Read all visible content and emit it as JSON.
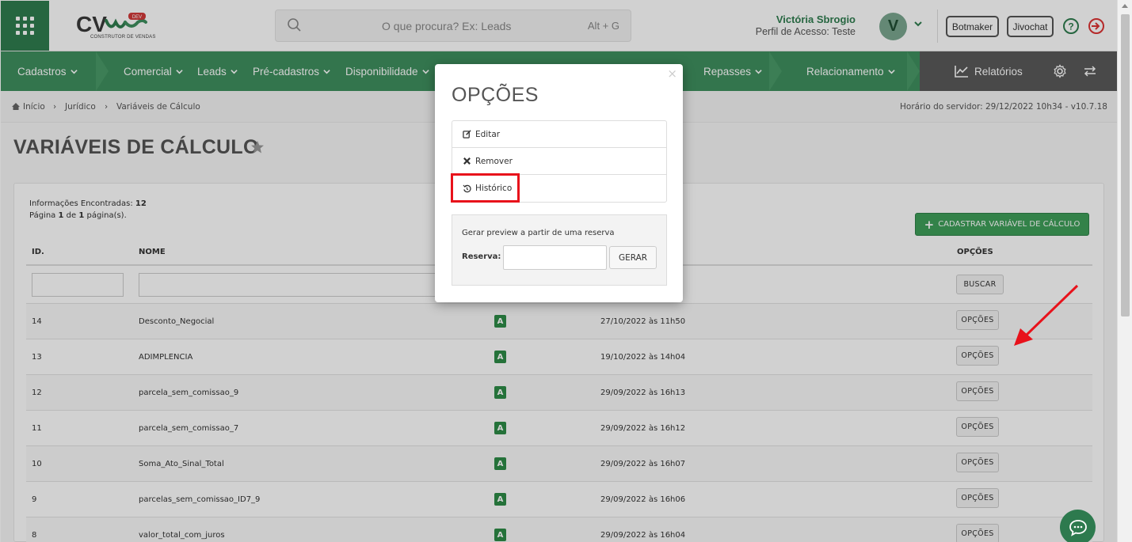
{
  "header": {
    "logo_text": "CV",
    "logo_badge": "DEV",
    "logo_subtitle": "CONSTRUTOR DE VENDAS",
    "search_placeholder": "O que procura? Ex: Leads",
    "search_shortcut": "Alt + G",
    "user_name": "Victória Sbrogio",
    "user_role": "Perfil de Acesso: Teste",
    "avatar_letter": "V",
    "buttons": [
      "Botmaker",
      "Jivochat"
    ]
  },
  "nav": {
    "items": [
      "Cadastros",
      "Comercial",
      "Leads",
      "Pré-cadastros",
      "Disponibilidade",
      "Repasses",
      "Relacionamento"
    ],
    "reports": "Relatórios"
  },
  "breadcrumb": {
    "items": [
      "Início",
      "Jurídico",
      "Variáveis de Cálculo"
    ],
    "server_time": "Horário do servidor: 29/12/2022 10h34 - v10.7.18"
  },
  "page": {
    "title": "VARIÁVEIS DE CÁLCULO",
    "info_found_label": "Informações Encontradas:",
    "info_found_value": "12",
    "page_info_pre": "Página",
    "page_info_current": "1",
    "page_info_mid": "de",
    "page_info_total": "1",
    "page_info_post": "página(s).",
    "add_button": "CADASTRAR VARIÁVEL DE CÁLCULO"
  },
  "table": {
    "headers": [
      "ID.",
      "NOME",
      "OPÇÕES"
    ],
    "search_button": "BUSCAR",
    "options_button": "OPÇÕES",
    "rows": [
      {
        "id": "14",
        "name": "Desconto_Negocial",
        "status": "A",
        "date": "27/10/2022 às 11h50"
      },
      {
        "id": "13",
        "name": "ADIMPLENCIA",
        "status": "A",
        "date": "19/10/2022 às 14h04"
      },
      {
        "id": "12",
        "name": "parcela_sem_comissao_9",
        "status": "A",
        "date": "29/09/2022 às 16h13"
      },
      {
        "id": "11",
        "name": "parcela_sem_comissao_7",
        "status": "A",
        "date": "29/09/2022 às 16h12"
      },
      {
        "id": "10",
        "name": "Soma_Ato_Sinal_Total",
        "status": "A",
        "date": "29/09/2022 às 16h07"
      },
      {
        "id": "9",
        "name": "parcelas_sem_comissao_ID7_9",
        "status": "A",
        "date": "29/09/2022 às 16h06"
      },
      {
        "id": "8",
        "name": "valor_total_com_juros",
        "status": "A",
        "date": "29/09/2022 às 16h04"
      }
    ]
  },
  "modal": {
    "title": "OPÇÕES",
    "close": "×",
    "options": [
      "Editar",
      "Remover",
      "Histórico"
    ],
    "preview_text": "Gerar preview a partir de uma reserva",
    "reserva_label": "Reserva:",
    "generate_button": "GERAR"
  },
  "colors": {
    "brand_green": "#3f8f5e",
    "dark_green": "#2f7d4f",
    "highlight_red": "#e8121b",
    "status_green": "#2e8b47"
  }
}
